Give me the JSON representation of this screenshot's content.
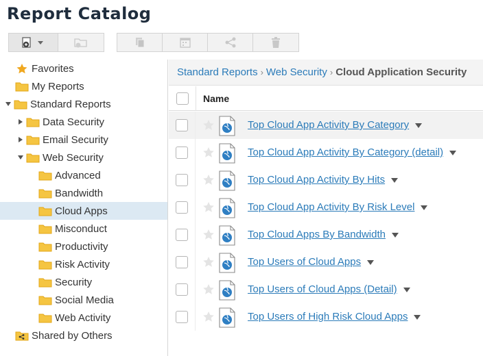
{
  "page": {
    "title": "Report Catalog"
  },
  "toolbar": {
    "buttons": [
      {
        "icon": "new-report-dropdown-icon",
        "enabled": true
      },
      {
        "icon": "new-folder-icon",
        "enabled": false
      },
      {
        "icon": "copy-icon",
        "enabled": false
      },
      {
        "icon": "schedule-calendar-icon",
        "enabled": false
      },
      {
        "icon": "share-icon",
        "enabled": false
      },
      {
        "icon": "delete-trash-icon",
        "enabled": false
      }
    ]
  },
  "tree": {
    "favorites": "Favorites",
    "my_reports": "My Reports",
    "standard_reports": "Standard Reports",
    "data_security": "Data Security",
    "email_security": "Email Security",
    "web_security": "Web Security",
    "web_children": [
      "Advanced",
      "Bandwidth",
      "Cloud Apps",
      "Misconduct",
      "Productivity",
      "Risk Activity",
      "Security",
      "Social Media",
      "Web Activity"
    ],
    "selected": "Cloud Apps",
    "shared": "Shared by Others"
  },
  "breadcrumb": {
    "items": [
      "Standard Reports",
      "Web Security"
    ],
    "current": "Cloud Application Security"
  },
  "table": {
    "name_header": "Name",
    "rows": [
      "Top Cloud App Activity By Category",
      "Top Cloud App Activity By Category (detail)",
      "Top Cloud App Activity By Hits",
      "Top Cloud App Activity By Risk Level",
      "Top Cloud Apps By Bandwidth",
      "Top Users of Cloud Apps",
      "Top Users of Cloud Apps (Detail)",
      "Top Users of High Risk Cloud Apps"
    ]
  },
  "colors": {
    "link": "#2b7bb9",
    "folder": "#f5c542",
    "selected_bg": "#dce9f3",
    "star_fav": "#f0a820"
  }
}
